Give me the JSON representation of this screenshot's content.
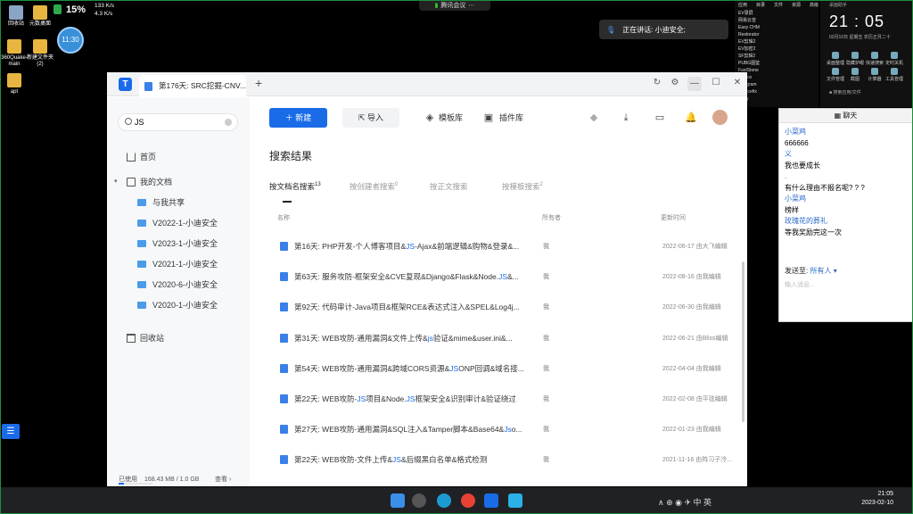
{
  "desktop": {
    "icons": [
      {
        "label": "回收站"
      },
      {
        "label": "元数桌面"
      },
      {
        "label": "360Quake-main"
      },
      {
        "label": "新建文件夹 (2)"
      },
      {
        "label": "apt"
      }
    ],
    "monitor": {
      "percent": "15%",
      "up": "133 K/s",
      "down": "4.3 K/s"
    },
    "timer": "11:30",
    "meeting_bar": "腾讯会议",
    "speaking": "正在讲话: 小迪安全;",
    "clock": {
      "time": "21 : 05",
      "date": "02月10日   星期五   农历正月二十"
    },
    "tools": [
      "应用",
      "目录",
      "文件",
      "资源",
      "高级"
    ],
    "tool_list": [
      "EV录屏",
      "网易云音",
      "Easy CHM",
      "Restorator",
      "EV剪辑2",
      "EV加密2",
      "SF剪辑2",
      "PUBG图鉴",
      "FastStone",
      "Firefox",
      "Telegram",
      "Sourcefix",
      "Copy"
    ],
    "widgets": [
      "桌面整理",
      "隐藏护眼",
      "快速搜索",
      "定时关机",
      "文件管理",
      "截图",
      "计算器",
      "工具管理"
    ],
    "search_hint": "■ 搜索应用/文件"
  },
  "chat": {
    "title": "聊天",
    "messages": [
      {
        "nick": "小菜鸡",
        "text": "666666"
      },
      {
        "nick": "义",
        "text": "我也要成长"
      },
      {
        "nick": ".",
        "text": "有什么理由不报名呢? ? ?"
      },
      {
        "nick": "小菜鸡",
        "text": "榜样"
      },
      {
        "nick": "玫瑰花的葬礼",
        "text": "等我奖励完这一次"
      }
    ],
    "send_to_label": "发送至:",
    "send_to_value": "所有人 ▾",
    "placeholder": "输入消息..."
  },
  "window": {
    "tab_title": "第176天: SRC挖掘-CNV...",
    "plus": "+",
    "controls": {
      "min": "—",
      "max": "☐",
      "close": "✕"
    },
    "search": {
      "value": "JS"
    },
    "nav": {
      "home": "首页",
      "mydocs": "我的文档",
      "shared": "与我共享",
      "folders": [
        "V2022-1-小迪安全",
        "V2023-1-小迪安全",
        "V2021-1-小迪安全",
        "V2020-6-小迪安全",
        "V2020-1-小迪安全"
      ],
      "trash": "回收站"
    },
    "usage": {
      "label": "已使用",
      "value": "168.43 MB / 1.0 GB",
      "link": "查看 ›",
      "fraction": 0.16
    },
    "toolbar": {
      "new": "新建",
      "import": "导入",
      "templates": "模板库",
      "plugins": "插件库"
    },
    "results_title": "搜索结果",
    "search_tabs": [
      {
        "label": "按文档名搜索",
        "count": "13"
      },
      {
        "label": "按创建者搜索",
        "count": "0"
      },
      {
        "label": "按正文搜索",
        "count": ""
      },
      {
        "label": "按模板搜索",
        "count": "2"
      }
    ],
    "columns": {
      "name": "名称",
      "owner": "所有者",
      "updated": "更新时间"
    },
    "rows": [
      {
        "name": "第16天: PHP开发-个人博客项目&JS-Ajax&前端逻辑&购物&登录&...",
        "owner": "我",
        "time": "2022-06-17 由大飞编辑"
      },
      {
        "name": "第63天: 服务攻防-框架安全&CVE复现&Django&Flask&Node.JS&...",
        "owner": "我",
        "time": "2022-08-16 由我编辑"
      },
      {
        "name": "第92天: 代码审计-Java项目&框架RCE&表达式注入&SPEL&Log4j...",
        "owner": "我",
        "time": "2022-06-30 由我编辑"
      },
      {
        "name": "第31天: WEB攻防-通用漏洞&文件上传&js验证&mime&user.ini&...",
        "owner": "我",
        "time": "2022-06-21 由Bliss编辑"
      },
      {
        "name": "第54天: WEB攻防-通用漏洞&跨域CORS资源&JSONP回调&域名接...",
        "owner": "我",
        "time": "2022-04-04 由我编辑"
      },
      {
        "name": "第22天: WEB攻防-JS项目&Node.JS框架安全&识别审计&验证绕过",
        "owner": "我",
        "time": "2022-02-08 由平弦编辑"
      },
      {
        "name": "第27天: WEB攻防-通用漏洞&SQL注入&Tamper脚本&Base64&Jso...",
        "owner": "我",
        "time": "2022-01-23 由我编辑"
      },
      {
        "name": "第22天: WEB攻防-文件上传&JS&后缀黑白名单&格式检测",
        "owner": "我",
        "time": "2021-11-16 由阵习子冷..."
      }
    ]
  },
  "taskbar": {
    "tray": "∧  ⊕  ◉  ✈  中  英",
    "time": "21:05",
    "date": "2023-02-10"
  }
}
